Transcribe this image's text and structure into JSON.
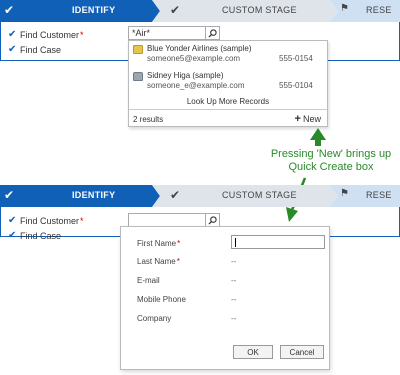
{
  "stages": {
    "active_label": "IDENTIFY",
    "middle_label": "CUSTOM STAGE",
    "last_label": "RESE"
  },
  "form": {
    "find_customer": "Find Customer",
    "find_case": "Find Case",
    "required_mark": "*"
  },
  "search": {
    "value": "*Air*"
  },
  "dropdown": {
    "results": [
      {
        "name": "Blue Yonder Airlines (sample)",
        "email": "someone5@example.com",
        "phone": "555-0154"
      },
      {
        "name": "Sidney Higa (sample)",
        "email": "someone_e@example.com",
        "phone": "555-0104"
      }
    ],
    "lookup_more": "Look Up More Records",
    "count": "2 results",
    "new_label": "New"
  },
  "annotation": "Pressing 'New' brings up Quick Create box",
  "quick_create": {
    "fields": [
      {
        "label": "First Name",
        "required": true,
        "value": ""
      },
      {
        "label": "Last Name",
        "required": true,
        "value": "--"
      },
      {
        "label": "E-mail",
        "required": false,
        "value": "--"
      },
      {
        "label": "Mobile Phone",
        "required": false,
        "value": "--"
      },
      {
        "label": "Company",
        "required": false,
        "value": "--"
      }
    ],
    "ok_label": "OK",
    "cancel_label": "Cancel"
  },
  "colors": {
    "accent": "#1060b8",
    "annotation": "#2a8a2a",
    "required": "#cc0000"
  }
}
